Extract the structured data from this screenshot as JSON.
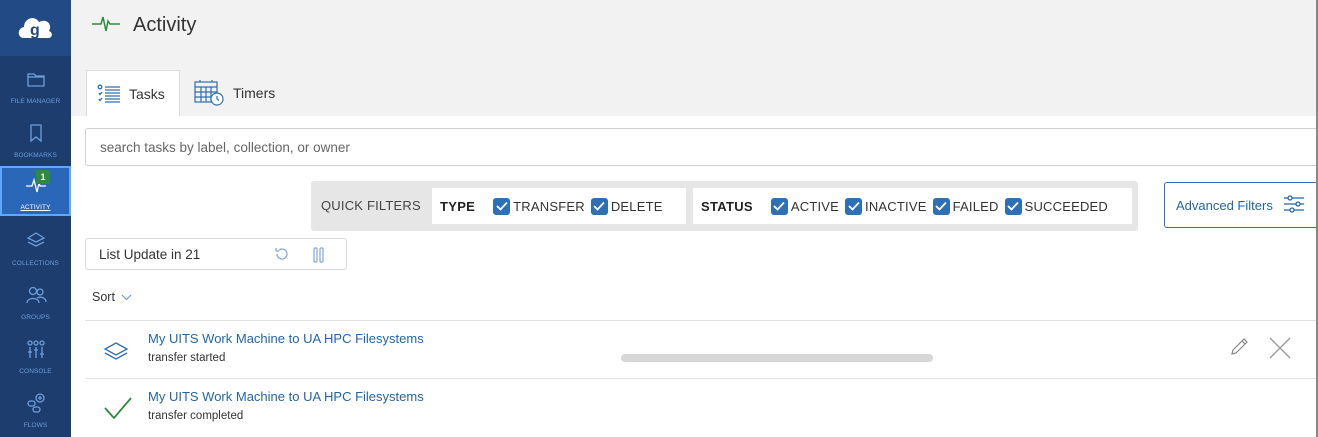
{
  "sidebar": {
    "logo_icon": "globus-logo-icon",
    "items": [
      {
        "label": "FILE MANAGER",
        "icon": "folder-icon",
        "active": false
      },
      {
        "label": "BOOKMARKS",
        "icon": "bookmark-icon",
        "active": false
      },
      {
        "label": "ACTIVITY",
        "icon": "activity-pulse-icon",
        "active": true,
        "badge": "1"
      },
      {
        "label": "COLLECTIONS",
        "icon": "layers-icon",
        "active": false
      },
      {
        "label": "GROUPS",
        "icon": "people-icon",
        "active": false
      },
      {
        "label": "CONSOLE",
        "icon": "sliders-icon",
        "active": false
      },
      {
        "label": "FLOWS",
        "icon": "flows-icon",
        "active": false
      }
    ]
  },
  "header": {
    "title": "Activity",
    "title_icon": "activity-pulse-icon",
    "tabs": [
      {
        "label": "Tasks",
        "icon": "task-list-icon",
        "selected": true
      },
      {
        "label": "Timers",
        "icon": "calendar-clock-icon",
        "selected": false
      }
    ]
  },
  "search": {
    "placeholder": "search tasks by label, collection, or owner",
    "value": ""
  },
  "quick_filters": {
    "label": "QUICK FILTERS",
    "type_group": {
      "title": "TYPE",
      "options": [
        {
          "label": "TRANSFER",
          "checked": true
        },
        {
          "label": "DELETE",
          "checked": true
        }
      ]
    },
    "status_group": {
      "title": "STATUS",
      "options": [
        {
          "label": "ACTIVE",
          "checked": true
        },
        {
          "label": "INACTIVE",
          "checked": true
        },
        {
          "label": "FAILED",
          "checked": true
        },
        {
          "label": "SUCCEEDED",
          "checked": true
        }
      ]
    },
    "advanced_label": "Advanced Filters",
    "advanced_icon": "filter-sliders-icon"
  },
  "list_update": {
    "label": "List Update in 21",
    "refresh_icon": "refresh-icon",
    "pause_icon": "pause-icon"
  },
  "sort": {
    "label": "Sort",
    "icon": "chevron-down-icon"
  },
  "tasks": [
    {
      "title": "My UITS Work Machine to UA HPC Filesystems",
      "status": "transfer started",
      "icon": "transfer-layers-icon",
      "in_progress": true
    },
    {
      "title": "My UITS Work Machine to UA HPC Filesystems",
      "status": "transfer completed",
      "icon": "checkmark-icon",
      "in_progress": false
    }
  ],
  "colors": {
    "sidebar_bg": "#1c3d6e",
    "sidebar_active": "#2a67b8",
    "accent_blue": "#2f6fb3",
    "link_blue": "#2465a8",
    "success_green": "#2e8b3d"
  }
}
